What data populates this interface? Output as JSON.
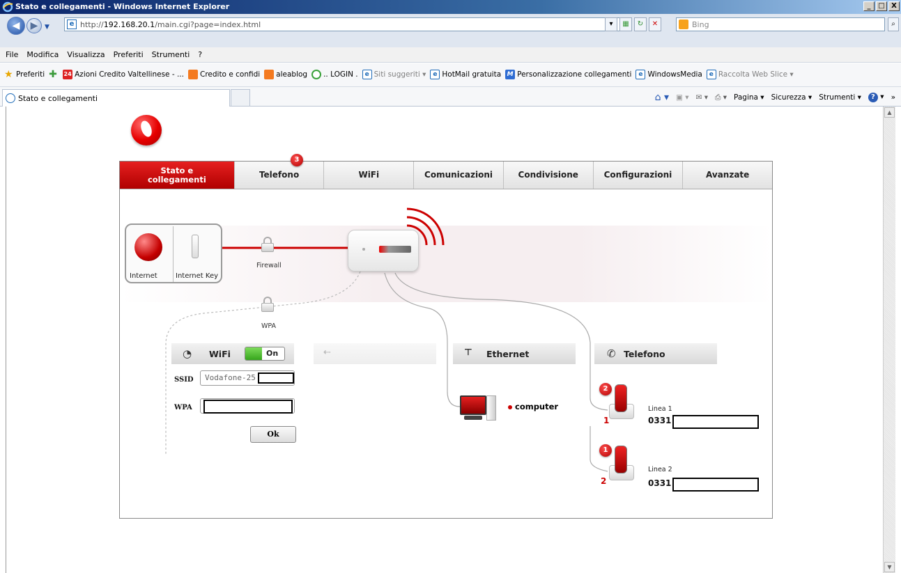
{
  "window": {
    "title": "Stato e collegamenti - Windows Internet Explorer",
    "controls": [
      "_",
      "□",
      "X"
    ]
  },
  "address": {
    "url_prefix": "http://",
    "url_host": "192.168.20.1",
    "url_path": "/main.cgi?page=index.html",
    "search_placeholder": "Bing"
  },
  "menu": [
    "File",
    "Modifica",
    "Visualizza",
    "Preferiti",
    "Strumenti",
    "?"
  ],
  "favorites": {
    "label": "Preferiti",
    "items": [
      {
        "icon": "red-24",
        "label": "Azioni Credito Valtellinese - ...",
        "muted": false
      },
      {
        "icon": "blogger",
        "label": "Credito e confidi",
        "muted": false
      },
      {
        "icon": "blogger",
        "label": "aleablog",
        "muted": false
      },
      {
        "icon": "green-ring",
        "label": ".. LOGIN .",
        "muted": false
      },
      {
        "icon": "ie",
        "label": "Siti suggeriti ▾",
        "muted": true
      },
      {
        "icon": "ie",
        "label": "HotMail gratuita",
        "muted": false
      },
      {
        "icon": "msn",
        "label": "Personalizzazione collegamenti",
        "muted": false
      },
      {
        "icon": "ie",
        "label": "WindowsMedia",
        "muted": false
      },
      {
        "icon": "ie",
        "label": "Raccolta Web Slice ▾",
        "muted": true
      }
    ]
  },
  "tab": {
    "label": "Stato e collegamenti"
  },
  "commandbar": {
    "pagina": "Pagina ▾",
    "sicurezza": "Sicurezza ▾",
    "strumenti": "Strumenti ▾",
    "more": "»"
  },
  "router_ui": {
    "nav": [
      {
        "label": "Stato e collegamenti",
        "active": true
      },
      {
        "label": "Telefono",
        "active": false,
        "badge": "3"
      },
      {
        "label": "WiFi",
        "active": false
      },
      {
        "label": "Comunicazioni",
        "active": false
      },
      {
        "label": "Condivisione",
        "active": false
      },
      {
        "label": "Configurazioni",
        "active": false
      },
      {
        "label": "Avanzate",
        "active": false
      }
    ],
    "diagram": {
      "internet_label": "Internet",
      "internet_key_label": "Internet Key",
      "firewall_label": "Firewall",
      "wpa_label": "WPA"
    },
    "wifi": {
      "header": "WiFi",
      "toggle": "On",
      "ssid_label": "SSID",
      "ssid_value": "Vodafone-25",
      "wpa_label": "WPA",
      "ok_button": "Ok"
    },
    "usb": {
      "header": "USB"
    },
    "ethernet": {
      "header": "Ethernet",
      "device": "computer"
    },
    "telefono": {
      "header": "Telefono",
      "lines": [
        {
          "badge": "2",
          "num": "1",
          "label": "Linea 1",
          "number": "0331"
        },
        {
          "badge": "1",
          "num": "2",
          "label": "Linea 2",
          "number": "0331"
        }
      ]
    }
  },
  "colors": {
    "vodafone_red": "#e60000",
    "toggle_green": "#36a51c"
  }
}
